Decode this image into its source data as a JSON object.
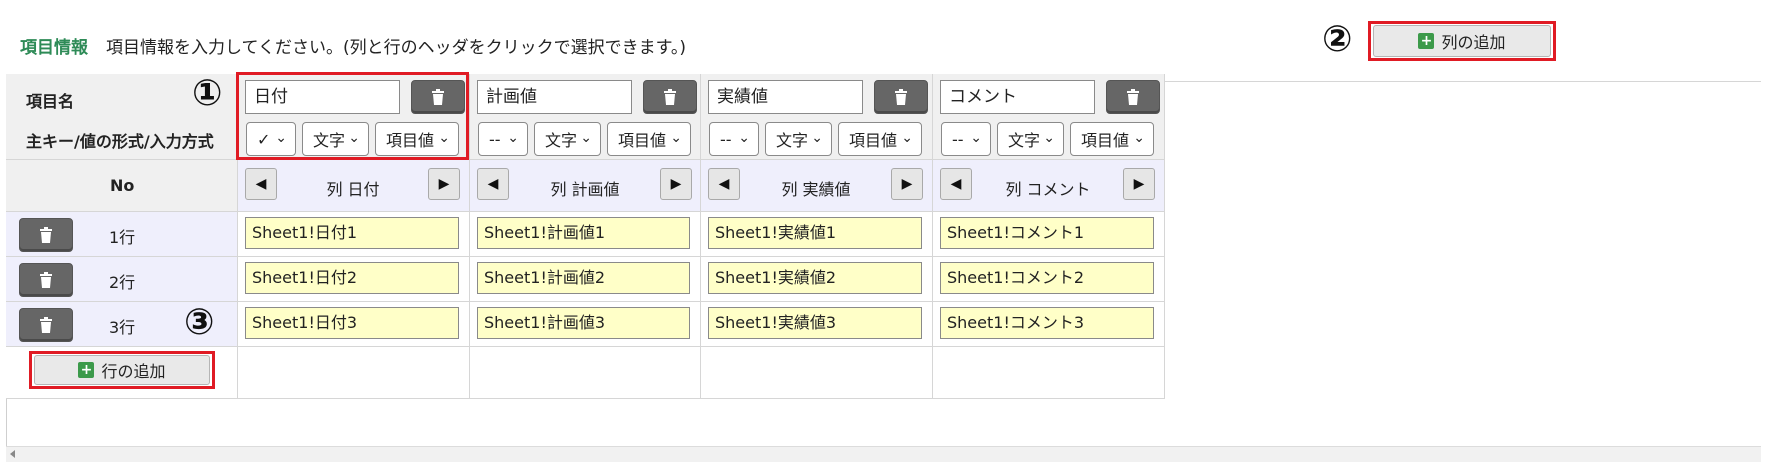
{
  "header": {
    "title": "項目情報",
    "instruction": "項目情報を入力してください。(列と行のヘッダをクリックで選択できます。)",
    "add_column_label": "列の追加"
  },
  "markers": {
    "one": "①",
    "two": "②",
    "three": "③"
  },
  "labels": {
    "item_name": "項目名",
    "key_format": "主キー/値の形式/入力方式",
    "no": "No",
    "add_row_label": "行の追加"
  },
  "columns": [
    {
      "name": "日付",
      "key": "✓",
      "format": "文字",
      "input": "項目値",
      "header": "列 日付"
    },
    {
      "name": "計画値",
      "key": "--",
      "format": "文字",
      "input": "項目値",
      "header": "列 計画値"
    },
    {
      "name": "実績値",
      "key": "--",
      "format": "文字",
      "input": "項目値",
      "header": "列 実績値"
    },
    {
      "name": "コメント",
      "key": "--",
      "format": "文字",
      "input": "項目値",
      "header": "列 コメント"
    }
  ],
  "rows": [
    {
      "label": "1行",
      "values": [
        "Sheet1!日付1",
        "Sheet1!計画値1",
        "Sheet1!実績値1",
        "Sheet1!コメント1"
      ]
    },
    {
      "label": "2行",
      "values": [
        "Sheet1!日付2",
        "Sheet1!計画値2",
        "Sheet1!実績値2",
        "Sheet1!コメント2"
      ]
    },
    {
      "label": "3行",
      "values": [
        "Sheet1!日付3",
        "Sheet1!計画値3",
        "Sheet1!実績値3",
        "Sheet1!コメント3"
      ]
    }
  ],
  "colors": {
    "accent": "#2e8b57",
    "highlight": "#e01b24",
    "cell_input": "#ffffc8",
    "column_header": "#efeffc"
  },
  "icons": {
    "delete": "trash-icon",
    "add": "plus-icon",
    "prev": "arrow-left-icon",
    "next": "arrow-right-icon",
    "dropdown": "chevron-down-icon"
  }
}
